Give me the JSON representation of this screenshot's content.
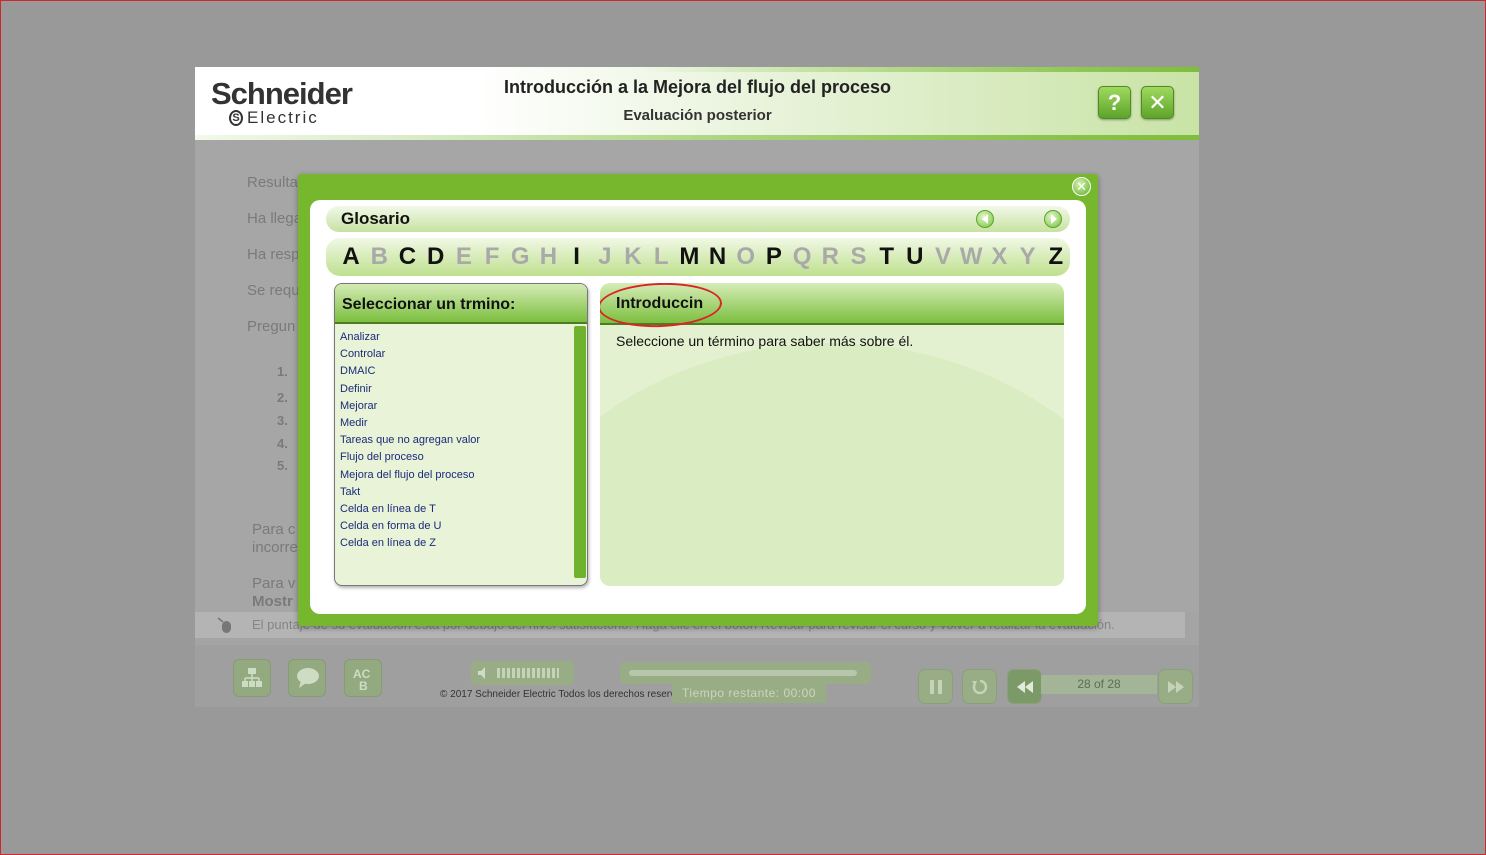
{
  "header": {
    "logo_line1": "Schneider",
    "logo_line2": "Electric",
    "course_title": "Introducción a la Mejora del flujo del proceso",
    "course_subtitle": "Evaluación posterior",
    "help_label": "?",
    "close_label": "✕"
  },
  "background": {
    "line1": "Resulta",
    "line2": "Ha llega",
    "line3": "Ha resp",
    "line4": "Se requ",
    "line5": "Pregun",
    "items": [
      "1.",
      "2.",
      "3.",
      "4.",
      "5."
    ],
    "para1_a": "Para c",
    "para1_b": "incorre",
    "para2_a": "Para v",
    "para2_b": "Mostr",
    "score_text": "El puntaje de su evaluación está por debajo del nivel satisfactorio. Haga clic en el botón Revisar para revisar el curso y volver a realizar la evaluación."
  },
  "footer": {
    "copyright": "© 2017 Schneider Electric Todos los derechos reservados.",
    "timer": "Tiempo restante:  00:00",
    "page_count": "28 of 28",
    "glossary_btn_label": "AC B"
  },
  "glossary": {
    "title": "Glosario",
    "close_label": "✕",
    "letters": [
      {
        "l": "A",
        "on": true
      },
      {
        "l": "B",
        "on": false
      },
      {
        "l": "C",
        "on": true
      },
      {
        "l": "D",
        "on": true
      },
      {
        "l": "E",
        "on": false
      },
      {
        "l": "F",
        "on": false
      },
      {
        "l": "G",
        "on": false
      },
      {
        "l": "H",
        "on": false
      },
      {
        "l": "I",
        "on": true
      },
      {
        "l": "J",
        "on": false
      },
      {
        "l": "K",
        "on": false
      },
      {
        "l": "L",
        "on": false
      },
      {
        "l": "M",
        "on": true
      },
      {
        "l": "N",
        "on": true
      },
      {
        "l": "O",
        "on": false
      },
      {
        "l": "P",
        "on": true
      },
      {
        "l": "Q",
        "on": false
      },
      {
        "l": "R",
        "on": false
      },
      {
        "l": "S",
        "on": false
      },
      {
        "l": "T",
        "on": true
      },
      {
        "l": "U",
        "on": true
      },
      {
        "l": "V",
        "on": false
      },
      {
        "l": "W",
        "on": false
      },
      {
        "l": "X",
        "on": false
      },
      {
        "l": "Y",
        "on": false
      },
      {
        "l": "Z",
        "on": true
      }
    ],
    "terms_heading": "Seleccionar un trmino:",
    "terms": [
      "Analizar",
      "Controlar",
      "DMAIC",
      "Definir",
      "Mejorar",
      "Medir",
      "Tareas que no agregan valor",
      "Flujo del proceso",
      "Mejora del flujo del proceso",
      "Takt",
      "Celda en línea de T",
      "Celda en forma de U",
      "Celda en línea de Z"
    ],
    "definition_heading": "Introduccin",
    "definition_text": "Seleccione un término para saber más sobre él."
  },
  "colors": {
    "accent_green": "#77b72d",
    "annotation_red": "#d9242a"
  }
}
